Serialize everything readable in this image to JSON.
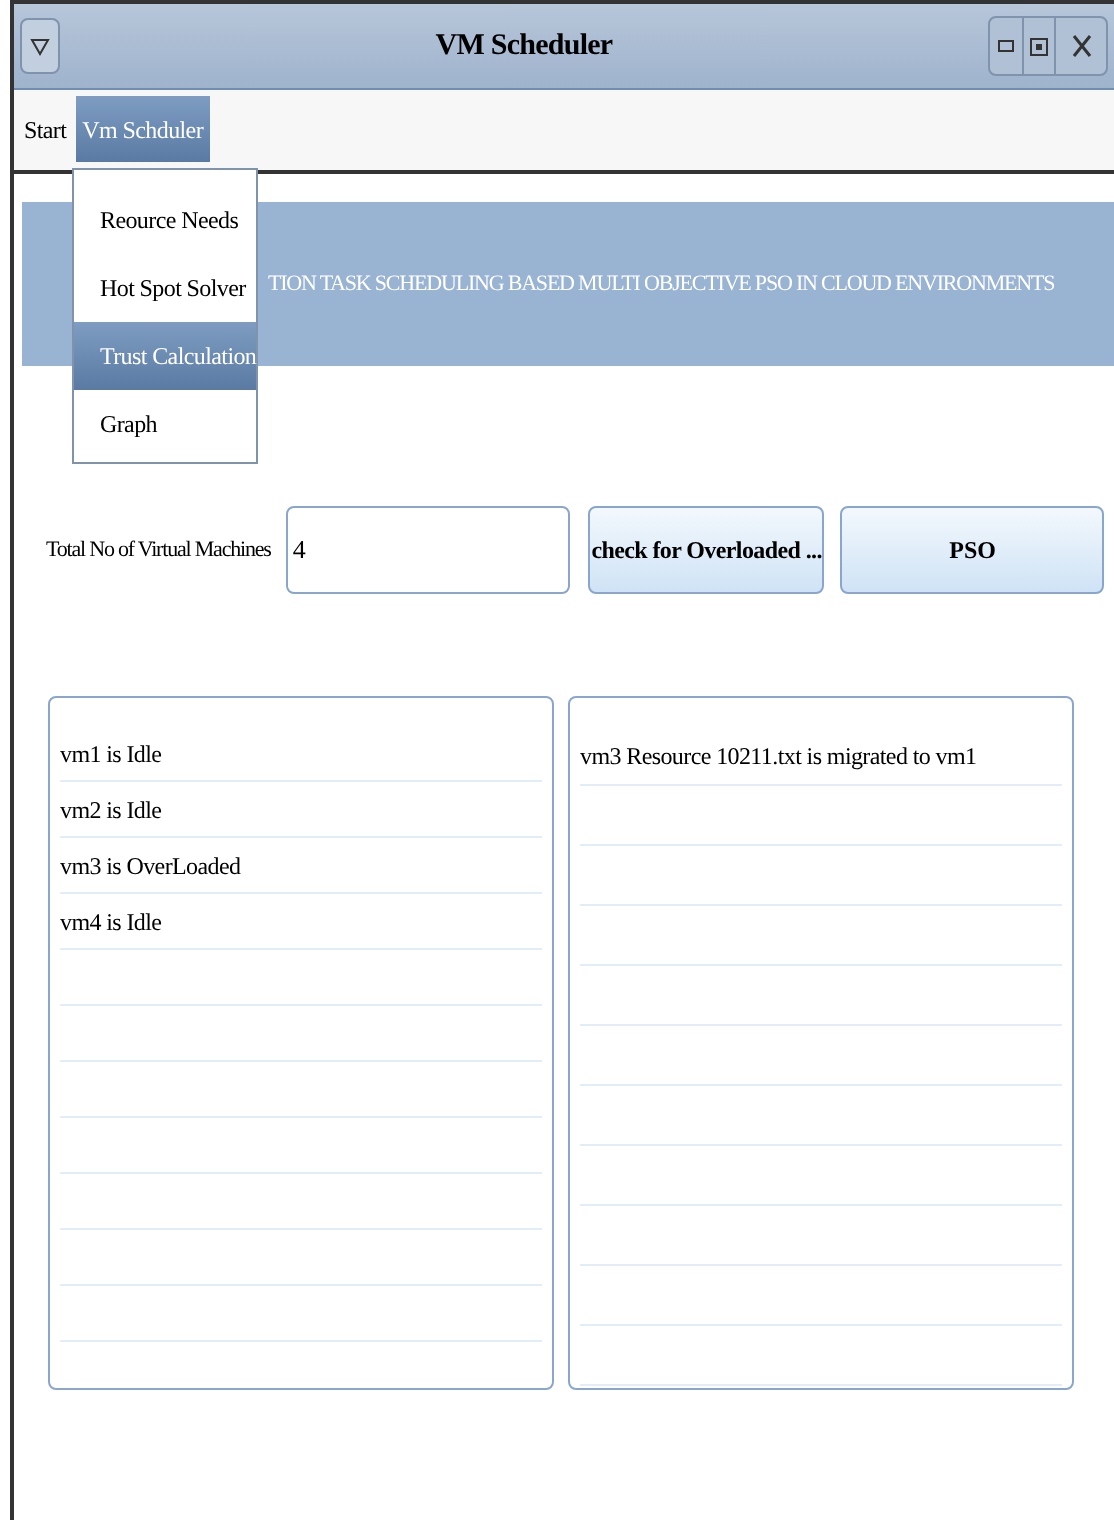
{
  "window": {
    "title": "VM Scheduler"
  },
  "menubar": [
    {
      "label": "Start",
      "selected": false
    },
    {
      "label": "Vm Schduler",
      "selected": true
    }
  ],
  "menu": [
    {
      "label": "Reource Needs",
      "selected": false
    },
    {
      "label": "Hot Spot Solver",
      "selected": false
    },
    {
      "label": "Trust Calculation",
      "selected": true
    },
    {
      "label": "Graph",
      "selected": false
    }
  ],
  "banner": "TION TASK SCHEDULING BASED MULTI OBJECTIVE PSO IN CLOUD ENVIRONMENTS",
  "vm_count": {
    "label": "Total No of Virtual Machines",
    "value": "4"
  },
  "buttons": [
    "check for Overloaded ...",
    "PSO"
  ],
  "status_list": [
    "vm1 is Idle",
    "vm2 is Idle",
    "vm3 is OverLoaded",
    "vm4 is Idle"
  ],
  "migration_list": [
    "vm3 Resource 10211.txt is migrated to vm1"
  ]
}
